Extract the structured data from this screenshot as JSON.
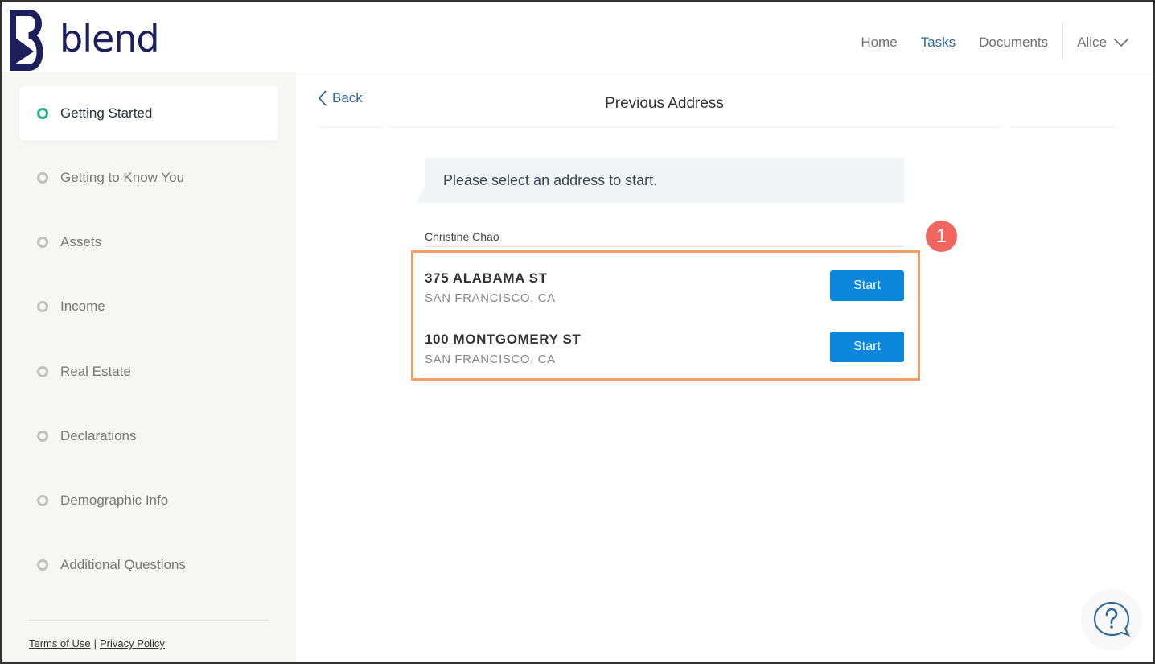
{
  "header": {
    "logo_text": "blend",
    "nav": [
      {
        "label": "Home",
        "active": false
      },
      {
        "label": "Tasks",
        "active": true
      },
      {
        "label": "Documents",
        "active": false
      }
    ],
    "user_name": "Alice"
  },
  "sidebar": {
    "steps": [
      {
        "label": "Getting Started",
        "active": true
      },
      {
        "label": "Getting to Know You",
        "active": false
      },
      {
        "label": "Assets",
        "active": false
      },
      {
        "label": "Income",
        "active": false
      },
      {
        "label": "Real Estate",
        "active": false
      },
      {
        "label": "Declarations",
        "active": false
      },
      {
        "label": "Demographic Info",
        "active": false
      },
      {
        "label": "Additional Questions",
        "active": false
      }
    ],
    "footer": {
      "terms": "Terms of Use",
      "separator": "|",
      "privacy": "Privacy Policy"
    }
  },
  "main": {
    "back_label": "Back",
    "title": "Previous Address",
    "prompt": "Please select an address to start.",
    "borrower_name": "Christine Chao",
    "addresses": [
      {
        "street": "375 ALABAMA ST",
        "city": "SAN FRANCISCO, CA",
        "button": "Start"
      },
      {
        "street": "100 MONTGOMERY ST",
        "city": "SAN FRANCISCO, CA",
        "button": "Start"
      }
    ],
    "annotation_badge": "1"
  },
  "colors": {
    "brand": "#1d1f5c",
    "accent": "#0a86db",
    "active_nav": "#2f6996",
    "active_step": "#25b58a",
    "highlight_border": "#f0a062",
    "badge": "#f0655d"
  }
}
